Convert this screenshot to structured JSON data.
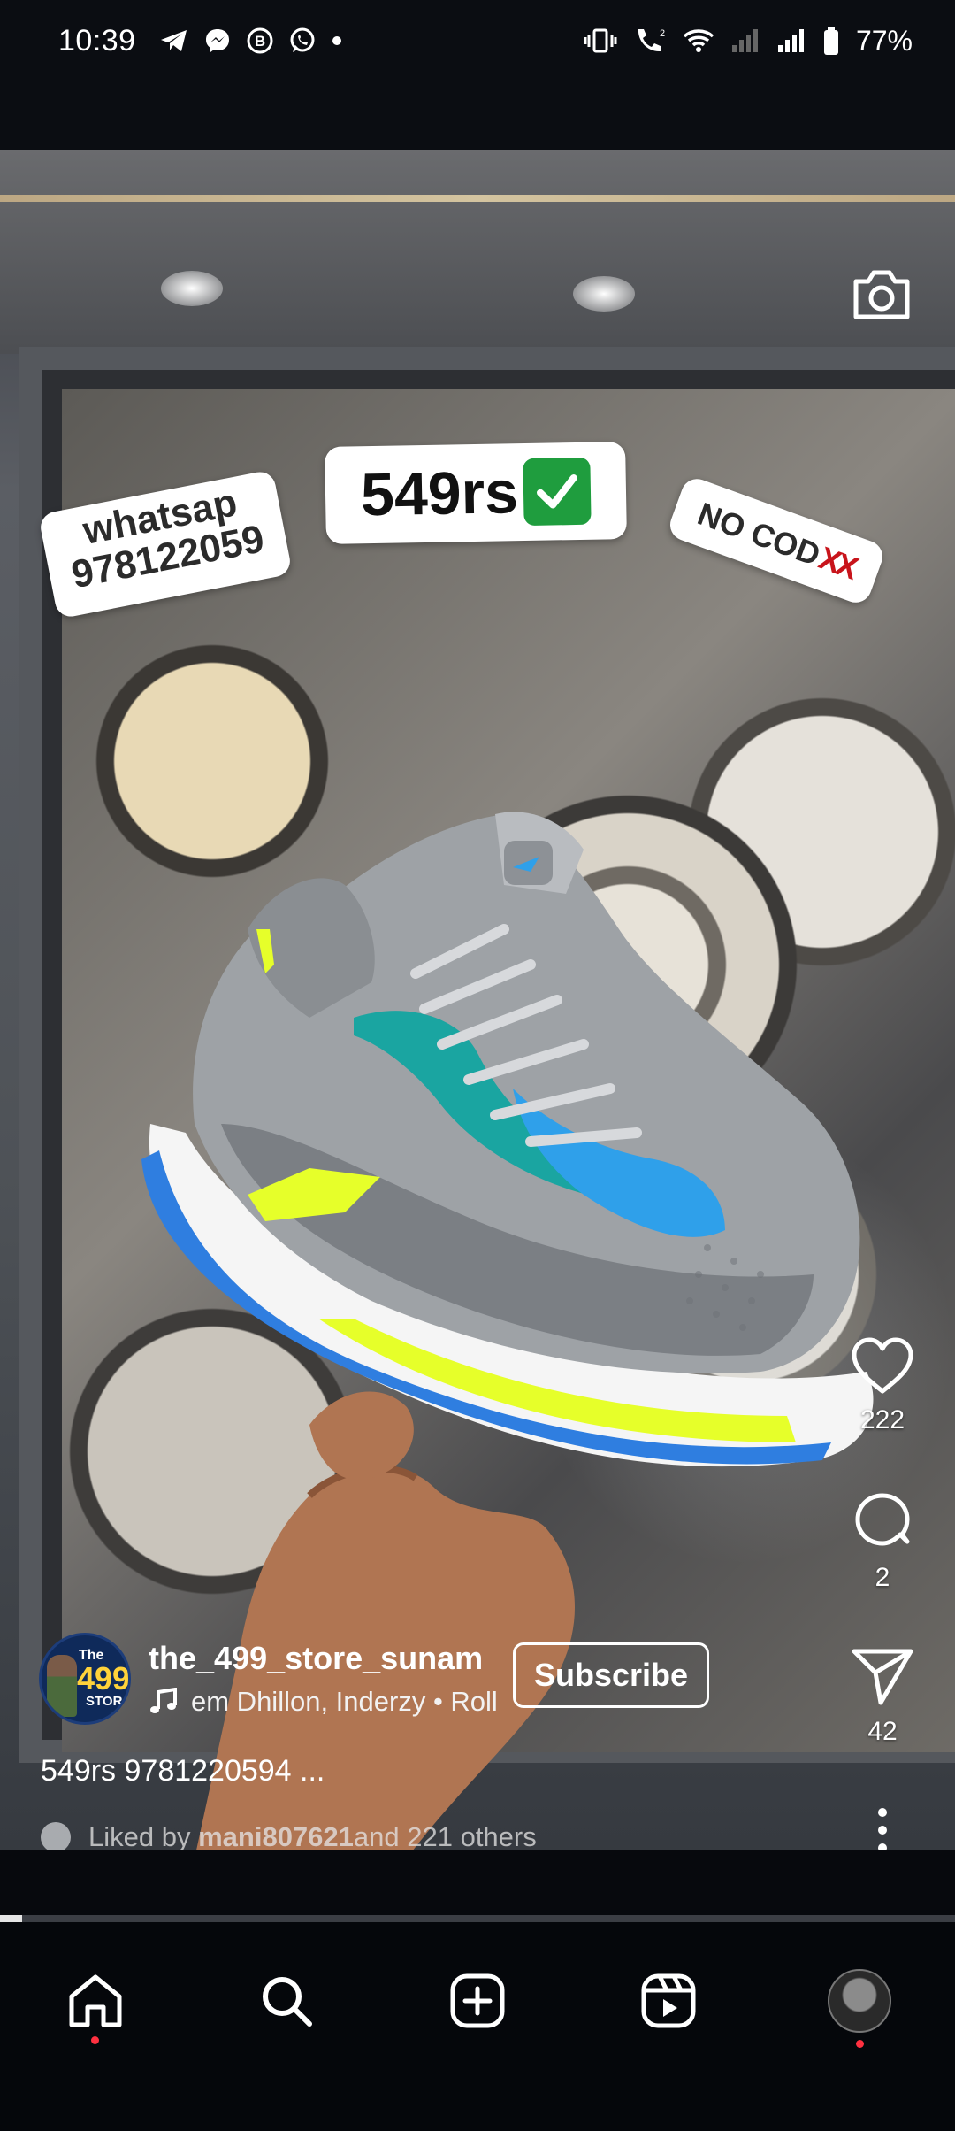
{
  "status_bar": {
    "time": "10:39",
    "battery_percent": "77%",
    "left_icons": [
      "telegram-icon",
      "messenger-icon",
      "b-icon",
      "whatsapp-icon",
      "dot-icon"
    ],
    "right_icons": [
      "vibrate-icon",
      "wifi-calling-icon",
      "wifi-icon",
      "signal-icon",
      "signal-icon",
      "battery-icon"
    ]
  },
  "reel": {
    "stickers": {
      "price": "549rs",
      "price_emoji": "✅",
      "whatsapp_line1": "whatsap",
      "whatsapp_line2": "978122059",
      "nocod": "NO COD",
      "nocod_mark": "XX"
    },
    "actions": {
      "likes": "222",
      "comments": "2",
      "shares": "42"
    },
    "account": {
      "username": "the_499_store_sunam",
      "avatar_line1": "The",
      "avatar_line2": "499",
      "avatar_line3": "STOR",
      "audio": "em Dhillon, Inderzy • Roll",
      "subscribe_label": "Subscribe"
    },
    "caption": "549rs 9781220594 ...",
    "liked_prefix": "Liked by ",
    "liked_user": "mani807621",
    "liked_suffix": " and 221 others",
    "progress": 0.023
  },
  "bottom_nav": {
    "items": [
      "home-icon",
      "search-icon",
      "create-icon",
      "reels-icon",
      "profile-avatar"
    ]
  }
}
